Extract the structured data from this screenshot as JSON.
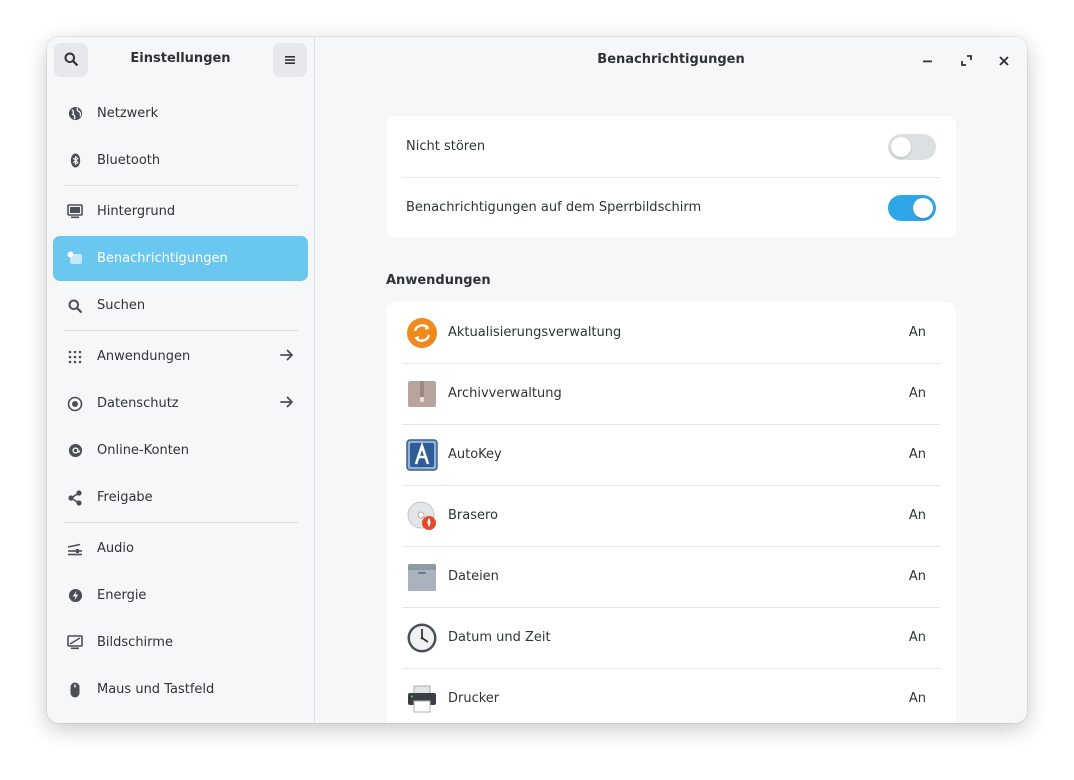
{
  "sidebar": {
    "title": "Einstellungen",
    "search_icon": "search-icon",
    "menu_icon": "hamburger-menu-icon",
    "items": [
      {
        "label": "Netzwerk",
        "icon": "globe-icon"
      },
      {
        "label": "Bluetooth",
        "icon": "bluetooth-icon"
      },
      {
        "label": "Hintergrund",
        "icon": "monitor-wallpaper-icon"
      },
      {
        "label": "Benachrichtigungen",
        "icon": "notification-icon",
        "active": true
      },
      {
        "label": "Suchen",
        "icon": "search-icon"
      },
      {
        "label": "Anwendungen",
        "icon": "grid-apps-icon",
        "has_arrow": true
      },
      {
        "label": "Datenschutz",
        "icon": "privacy-icon",
        "has_arrow": true
      },
      {
        "label": "Online-Konten",
        "icon": "at-sign-icon"
      },
      {
        "label": "Freigabe",
        "icon": "share-icon"
      },
      {
        "label": "Audio",
        "icon": "audio-mixer-icon"
      },
      {
        "label": "Energie",
        "icon": "power-bolt-icon"
      },
      {
        "label": "Bildschirme",
        "icon": "display-icon"
      },
      {
        "label": "Maus und Tastfeld",
        "icon": "mouse-icon"
      }
    ]
  },
  "header": {
    "title": "Benachrichtigungen"
  },
  "window_controls": {
    "minimize_icon": "minimize-icon",
    "maximize_icon": "maximize-icon",
    "close_icon": "close-icon"
  },
  "settings": {
    "dnd_label": "Nicht stören",
    "dnd_on": false,
    "lock_label": "Benachrichtigungen auf dem Sperrbildschirm",
    "lock_on": true
  },
  "apps": {
    "title": "Anwendungen",
    "list": [
      {
        "name": "Aktualisierungsverwaltung",
        "status": "An",
        "icon": "update-manager-icon"
      },
      {
        "name": "Archivverwaltung",
        "status": "An",
        "icon": "archive-icon"
      },
      {
        "name": "AutoKey",
        "status": "An",
        "icon": "autokey-icon"
      },
      {
        "name": "Brasero",
        "status": "An",
        "icon": "brasero-disc-icon"
      },
      {
        "name": "Dateien",
        "status": "An",
        "icon": "folder-icon"
      },
      {
        "name": "Datum und Zeit",
        "status": "An",
        "icon": "clock-icon"
      },
      {
        "name": "Drucker",
        "status": "An",
        "icon": "printer-icon"
      }
    ]
  },
  "colors": {
    "accent": "#2ea6e8",
    "sidebar_active": "#6ac8f0"
  }
}
